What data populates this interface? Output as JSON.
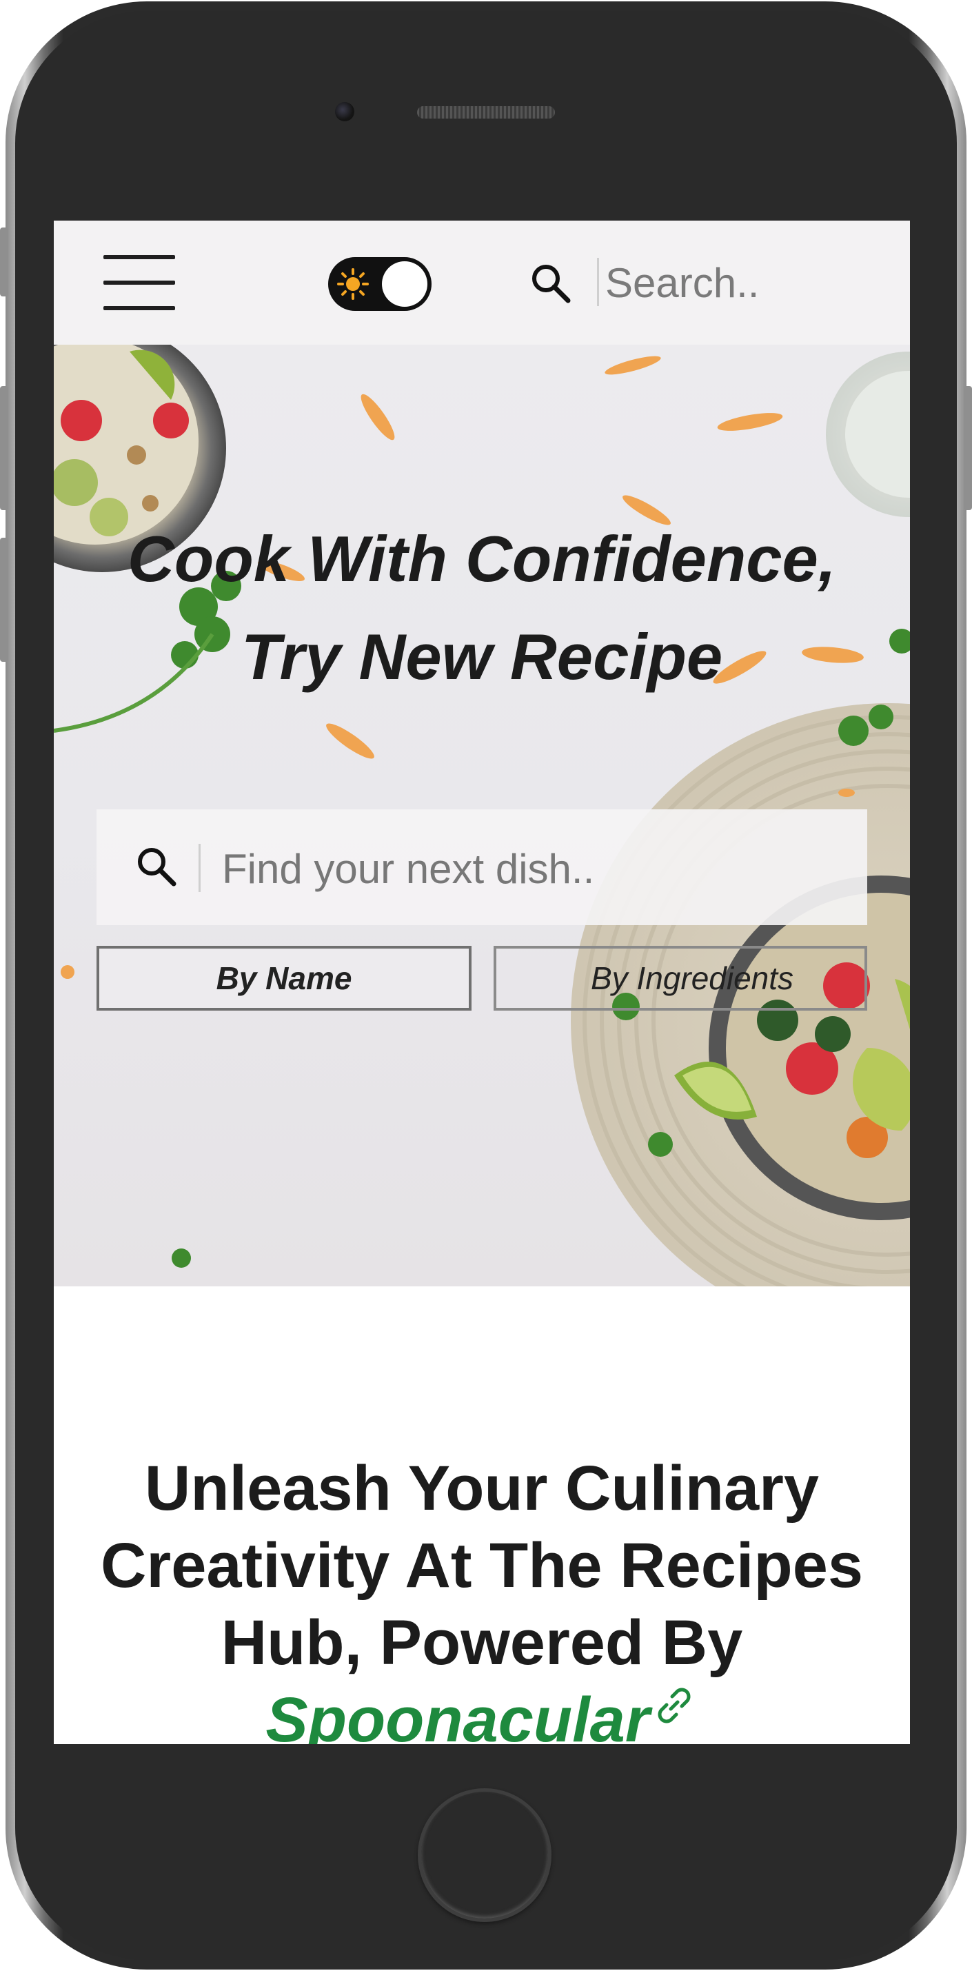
{
  "header": {
    "search_placeholder": "Search..",
    "theme_toggle": {
      "icon": "sun-icon",
      "state": "light"
    },
    "menu_icon": "hamburger-menu-icon"
  },
  "hero": {
    "title_line1": "Cook With Confidence,",
    "title_line2": "Try New Recipe",
    "search_placeholder": "Find your next dish..",
    "search_modes": [
      {
        "label": "By Name",
        "active": true
      },
      {
        "label": "By Ingredients",
        "active": false
      }
    ]
  },
  "intro": {
    "heading_text": "Unleash Your Culinary Creativity At The Recipes Hub, Powered By",
    "brand_link": "Spoonacular"
  },
  "colors": {
    "brand_green": "#1e8a3e",
    "toggle_bg": "#111111",
    "sun": "#f5a623",
    "text_dark": "#1c1c1c"
  }
}
